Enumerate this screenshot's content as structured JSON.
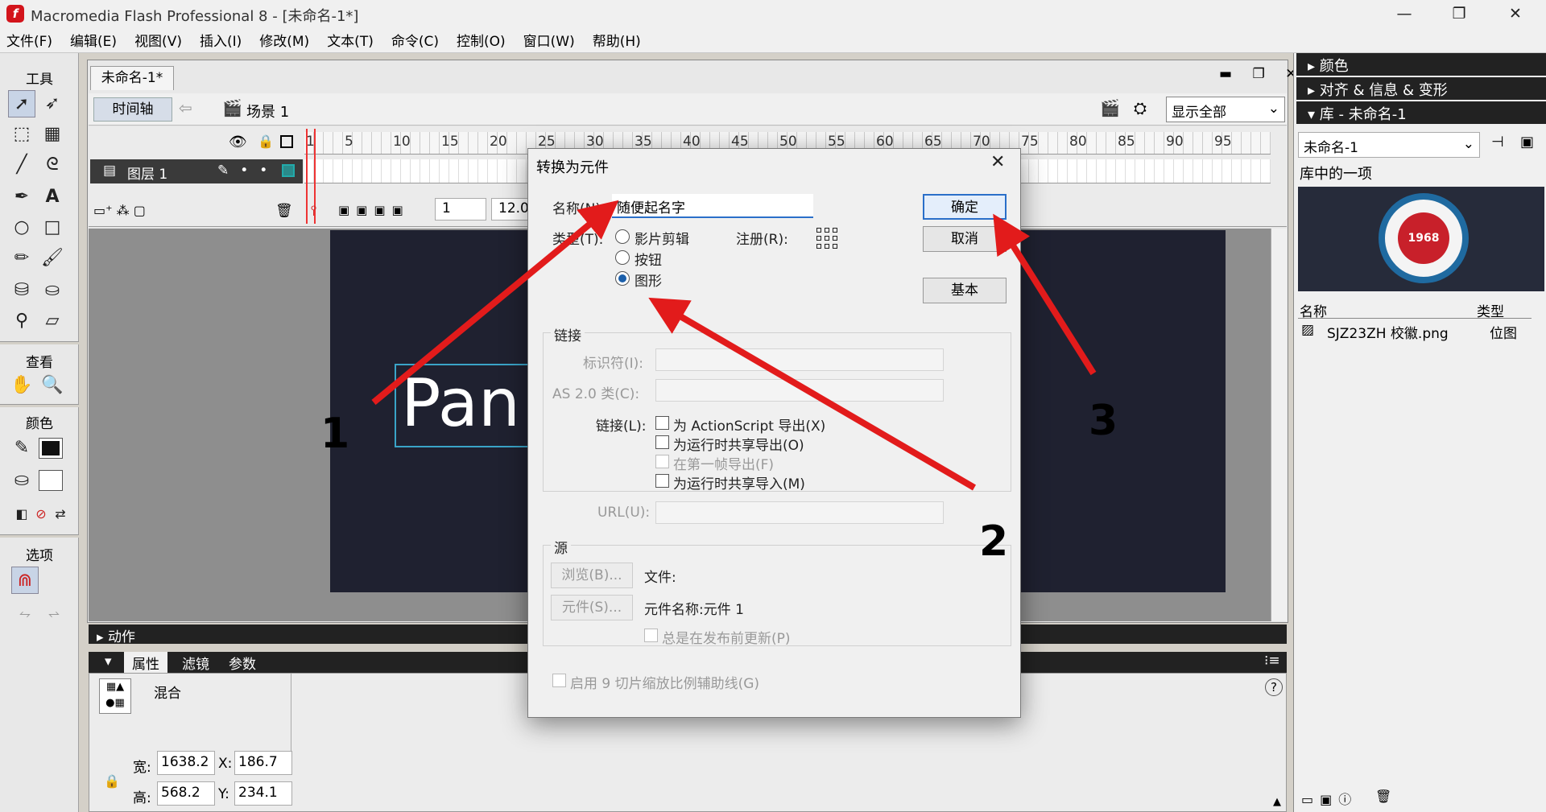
{
  "window": {
    "title": "Macromedia Flash Professional 8 - [未命名-1*]",
    "logo_letter": "f",
    "minimize": "—",
    "restore": "❐",
    "close": "✕"
  },
  "menu": [
    "文件(F)",
    "编辑(E)",
    "视图(V)",
    "插入(I)",
    "修改(M)",
    "文本(T)",
    "命令(C)",
    "控制(O)",
    "窗口(W)",
    "帮助(H)"
  ],
  "tools": {
    "tools_label": "工具",
    "view_label": "查看",
    "colors_label": "颜色",
    "options_label": "选项"
  },
  "document": {
    "tab": "未命名-1*",
    "timeline_button": "时间轴",
    "scene": "场景 1",
    "view_select": "显示全部",
    "layer_name": "图层 1",
    "ruler_numbers": [
      "1",
      "5",
      "10",
      "15",
      "20",
      "25",
      "30",
      "35",
      "40",
      "45",
      "50",
      "55",
      "60",
      "65",
      "70",
      "75",
      "80",
      "85",
      "90",
      "95"
    ],
    "frame": "1",
    "fps": "12.0 fps",
    "stage_text": "Pan"
  },
  "panels": {
    "actions": "动作",
    "properties_tabs": [
      "属性",
      "滤镜",
      "参数"
    ],
    "blend_label": "混合",
    "width_label": "宽:",
    "width_value": "1638.2",
    "height_label": "高:",
    "height_value": "568.2",
    "x_label": "X:",
    "x_value": "186.7",
    "y_label": "Y:",
    "y_value": "234.1",
    "help": "?"
  },
  "right": {
    "color": "颜色",
    "align": "对齐 & 信息 & 变形",
    "library": "库 - 未命名-1",
    "library_select": "未命名-1",
    "library_count": "库中的一项",
    "logo_year": "1968",
    "col_name": "名称",
    "col_type": "类型",
    "item_name": "SJZ23ZH 校徽.png",
    "item_type": "位图"
  },
  "dialog": {
    "title": "转换为元件",
    "name_label": "名称(N):",
    "name_value": "随便起名字",
    "type_label": "类型(T):",
    "type_options": [
      "影片剪辑",
      "按钮",
      "图形"
    ],
    "type_selected": 2,
    "registration_label": "注册(R):",
    "ok": "确定",
    "cancel": "取消",
    "basic": "基本",
    "linkage_section": "链接",
    "identifier_label": "标识符(I):",
    "as2_label": "AS 2.0 类(C):",
    "linkage_label": "链接(L):",
    "linkage_options": [
      "为 ActionScript 导出(X)",
      "为运行时共享导出(O)",
      "在第一帧导出(F)",
      "为运行时共享导入(M)"
    ],
    "url_label": "URL(U):",
    "source_section": "源",
    "browse": "浏览(B)...",
    "file_label": "文件:",
    "symbol_btn": "元件(S)...",
    "symbol_name": "元件名称:元件 1",
    "always_update": "总是在发布前更新(P)",
    "nine_slice": "启用 9 切片缩放比例辅助线(G)"
  },
  "annotations": {
    "numbers": [
      "1",
      "2",
      "3"
    ],
    "color": "#e21b1b"
  }
}
